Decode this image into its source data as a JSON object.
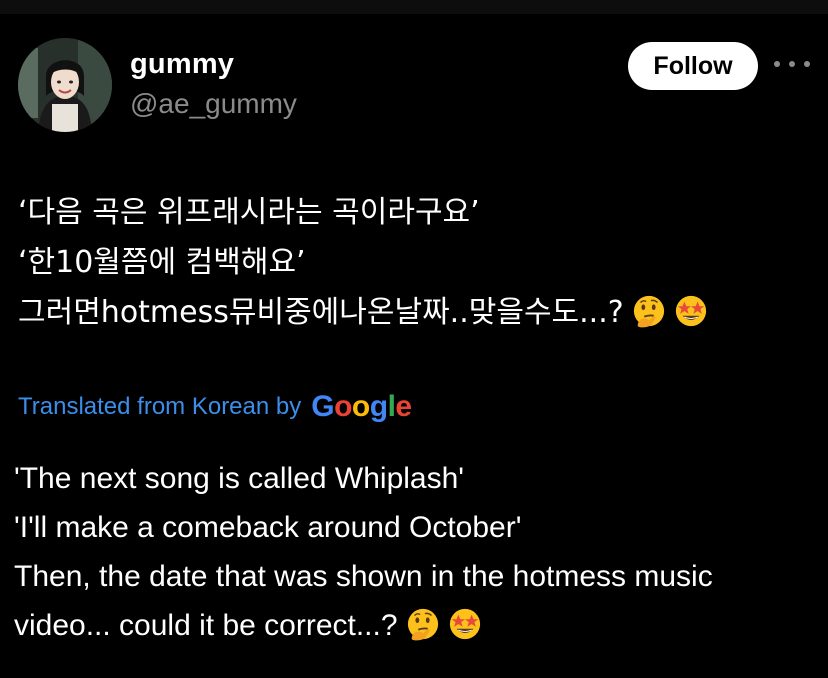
{
  "user": {
    "display_name": "gummy",
    "handle": "@ae_gummy"
  },
  "actions": {
    "follow_label": "Follow"
  },
  "post": {
    "lines": [
      "‘다음 곡은 위프래시라는 곡이라구요’",
      "‘한10월쯤에 컴백해요’",
      "그러면hotmess뮤비중에나온날짜..맞을수도...?"
    ]
  },
  "translation": {
    "label": "Translated from Korean by",
    "provider": "Google",
    "lines": [
      "'The next song is called Whiplash'",
      "'I'll make a comeback around October'",
      "Then, the date that was shown in the hotmess music",
      "video... could it be correct...?"
    ]
  },
  "icons": {
    "emoji_1": "thinking-face-icon",
    "emoji_2": "star-struck-icon",
    "more": "more-horizontal-icon"
  },
  "colors": {
    "background": "#000000",
    "secondary_text": "#8b8b8b",
    "link": "#3b8eea",
    "google_blue": "#4285f4",
    "google_red": "#ea4335",
    "google_yellow": "#fbbc05",
    "google_green": "#34a853"
  }
}
